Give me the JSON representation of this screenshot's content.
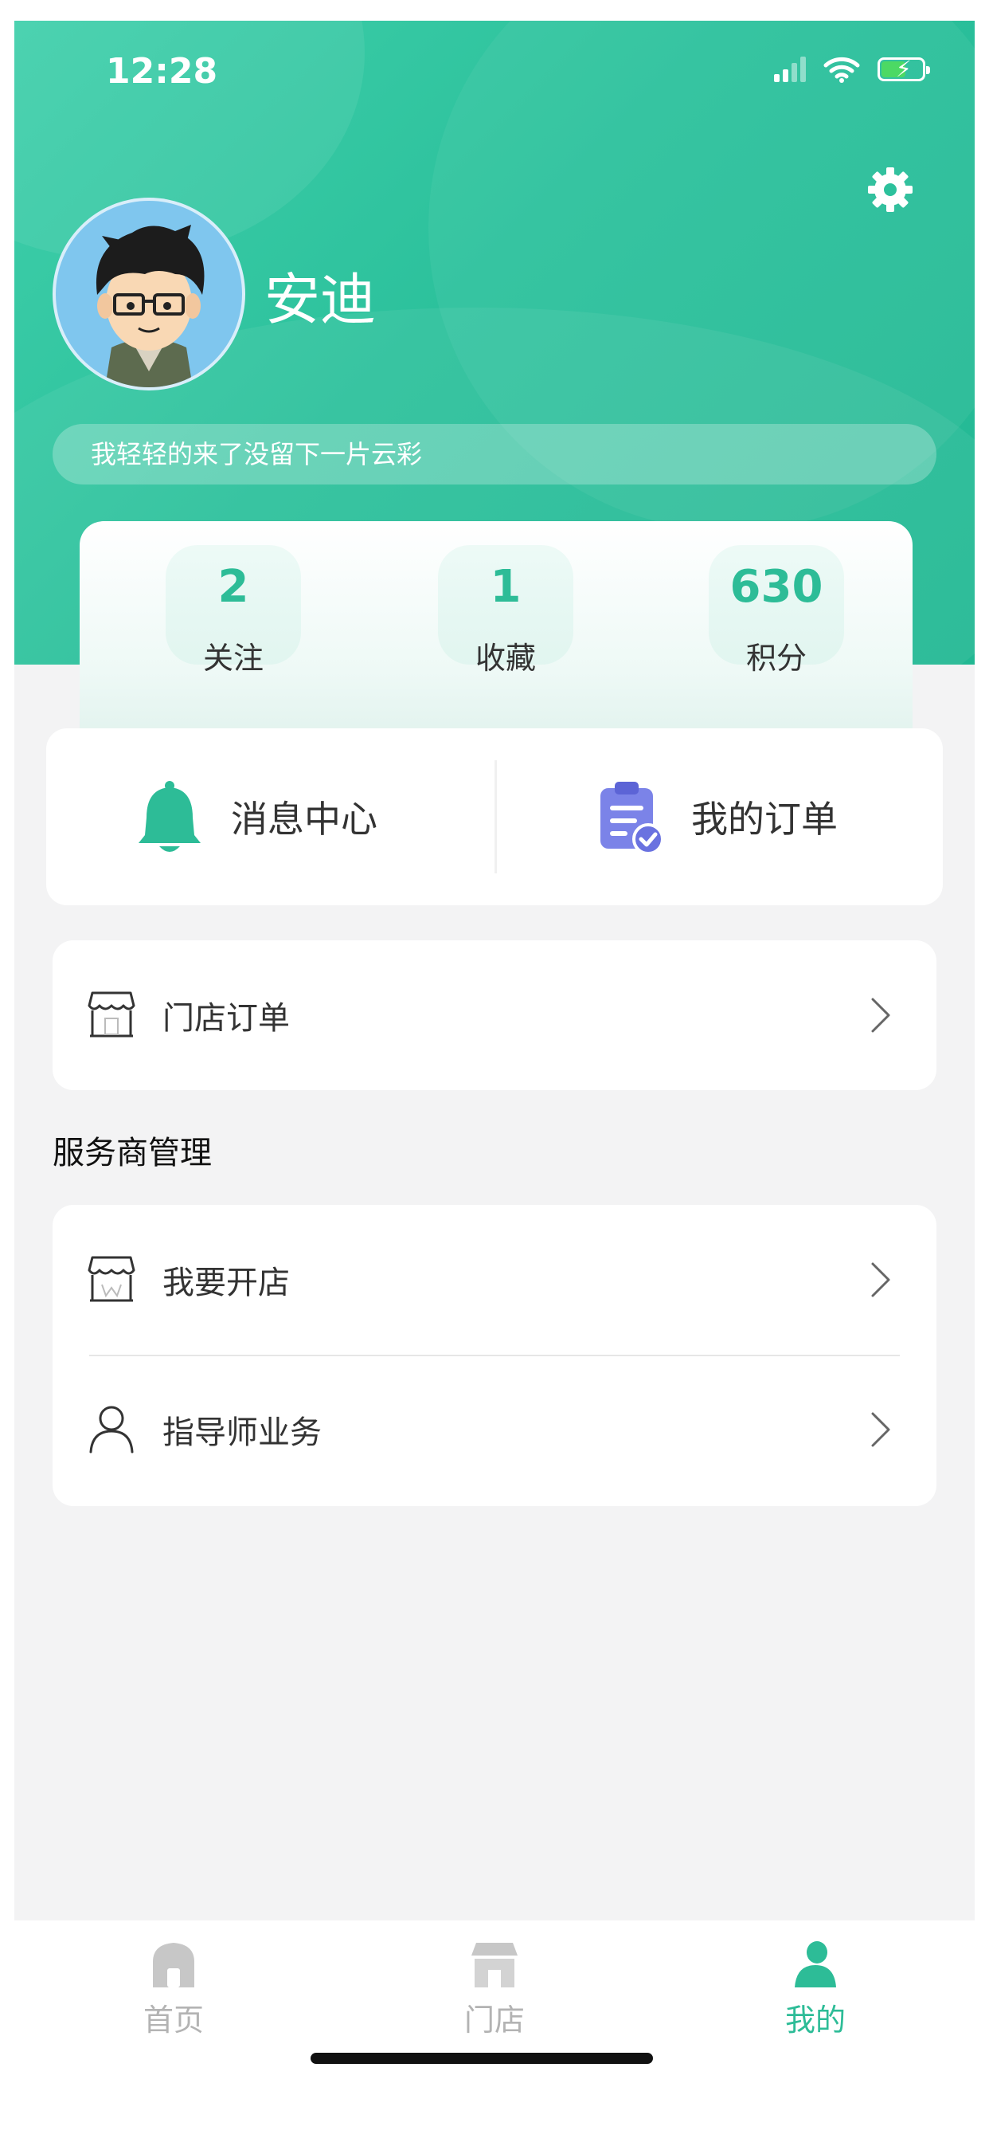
{
  "status_bar": {
    "time": "12:28"
  },
  "profile": {
    "username": "安迪",
    "signature": "我轻轻的来了没留下一片云彩"
  },
  "stats": [
    {
      "value": "2",
      "label": "关注"
    },
    {
      "value": "1",
      "label": "收藏"
    },
    {
      "value": "630",
      "label": "积分"
    }
  ],
  "quick_actions": {
    "messages": "消息中心",
    "orders": "我的订单"
  },
  "menu": {
    "store_orders": "门店订单",
    "section_title": "服务商管理",
    "open_store": "我要开店",
    "mentor_business": "指导师业务"
  },
  "tabbar": {
    "home": "首页",
    "store": "门店",
    "mine": "我的"
  },
  "colors": {
    "brand": "#2dbc97",
    "order_icon": "#7b83e8",
    "inactive_tab": "#b3b3b3"
  }
}
